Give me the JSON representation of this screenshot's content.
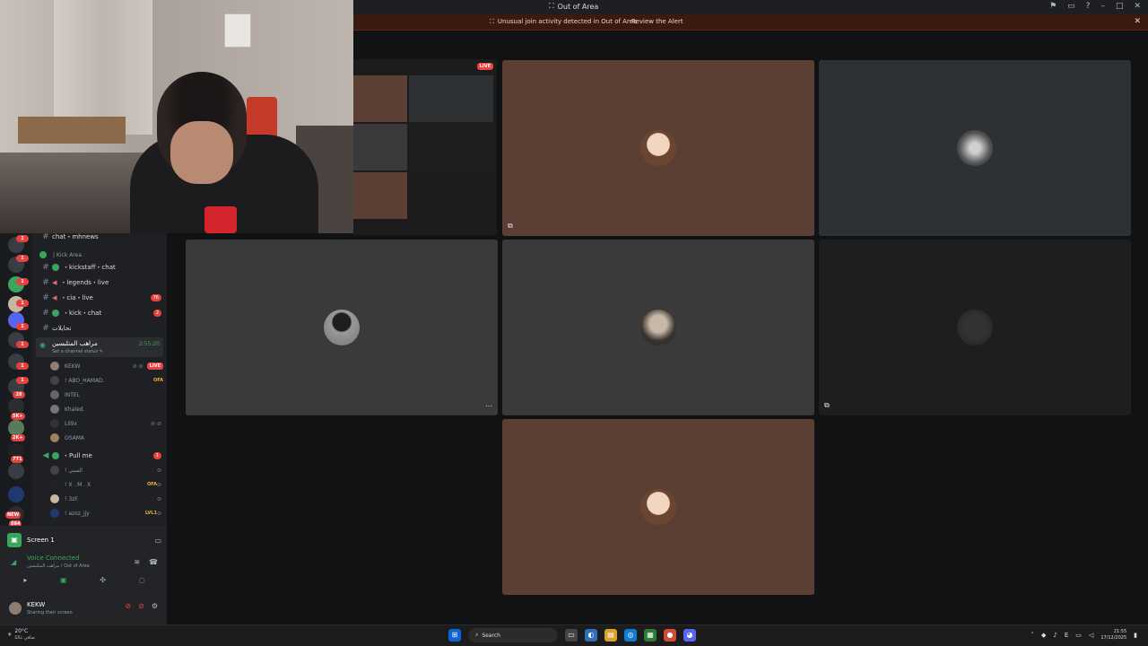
{
  "window": {
    "title": "Out of Area"
  },
  "alert": {
    "text": "Unusual join activity detected in Out of Area",
    "action": "Review the Alert"
  },
  "rail_badges": [
    "1",
    "1",
    "1",
    "1",
    "1",
    "1",
    "1",
    "1",
    "28",
    "5K+",
    "2K+",
    "771",
    "NEW",
    "884"
  ],
  "channels": {
    "top_channel": "chat・mhnews",
    "category": "| Kick Area",
    "items": [
      {
        "label": "・kickstaff・chat",
        "type": "text-green",
        "count": ""
      },
      {
        "label": "・legends・live",
        "type": "megaphone",
        "count": ""
      },
      {
        "label": "・cia・live",
        "type": "megaphone",
        "count": "76"
      },
      {
        "label": "・kick・chat",
        "type": "text-green",
        "count": "2"
      },
      {
        "label": "تحايلات",
        "type": "text",
        "count": ""
      }
    ],
    "voice_channel": {
      "name": "مراهب المتلبسين",
      "status": "Set a channel status ✎",
      "time": "2:55:20"
    },
    "voice_users": [
      {
        "name": "KEKW",
        "tag": "",
        "live": "LIVE",
        "icons": "⊘ ⊘"
      },
      {
        "name": "! ABO_HAMAD.",
        "tag": "OFA",
        "live": "",
        "icons": ""
      },
      {
        "name": "INTEL",
        "tag": "",
        "live": "",
        "icons": ""
      },
      {
        "name": "Khaled.",
        "tag": "",
        "live": "",
        "icons": ""
      },
      {
        "name": "Lil9x",
        "tag": "",
        "live": "",
        "icons": "⊘ ⊘"
      },
      {
        "name": "OSAMA",
        "tag": "",
        "live": "",
        "icons": ""
      }
    ],
    "pull_channel": {
      "name": "・Pull me",
      "count": "1"
    },
    "pull_users": [
      {
        "name": "! السبي",
        "tag": "",
        "icons": "⊘"
      },
      {
        "name": "! X . M . X",
        "tag": "OFA",
        "icons": "⊘"
      },
      {
        "name": "! 3zF.",
        "tag": "",
        "icons": "⊘"
      },
      {
        "name": "! azoz_jjy",
        "tag": "LVL1",
        "icons": "⊘"
      }
    ]
  },
  "panel": {
    "screen_label": "Screen 1",
    "voice_title": "Voice Connected",
    "voice_sub": "مراهب المتلبسين / Out of Area",
    "user_name": "KEKW",
    "user_status": "Sharing their screen"
  },
  "stage": {
    "live_chip": "LIVE",
    "tile_colors": {
      "brown": "#5b3f34",
      "slate": "#2e3133",
      "gray": "#3a3a3a",
      "dark": "#1e1e1e"
    }
  },
  "taskbar": {
    "weather_temp": "20°C",
    "weather_desc": "صافي غالبًا",
    "search": "Search",
    "time": "21:55",
    "date": "17/12/2025",
    "lang": "E"
  }
}
